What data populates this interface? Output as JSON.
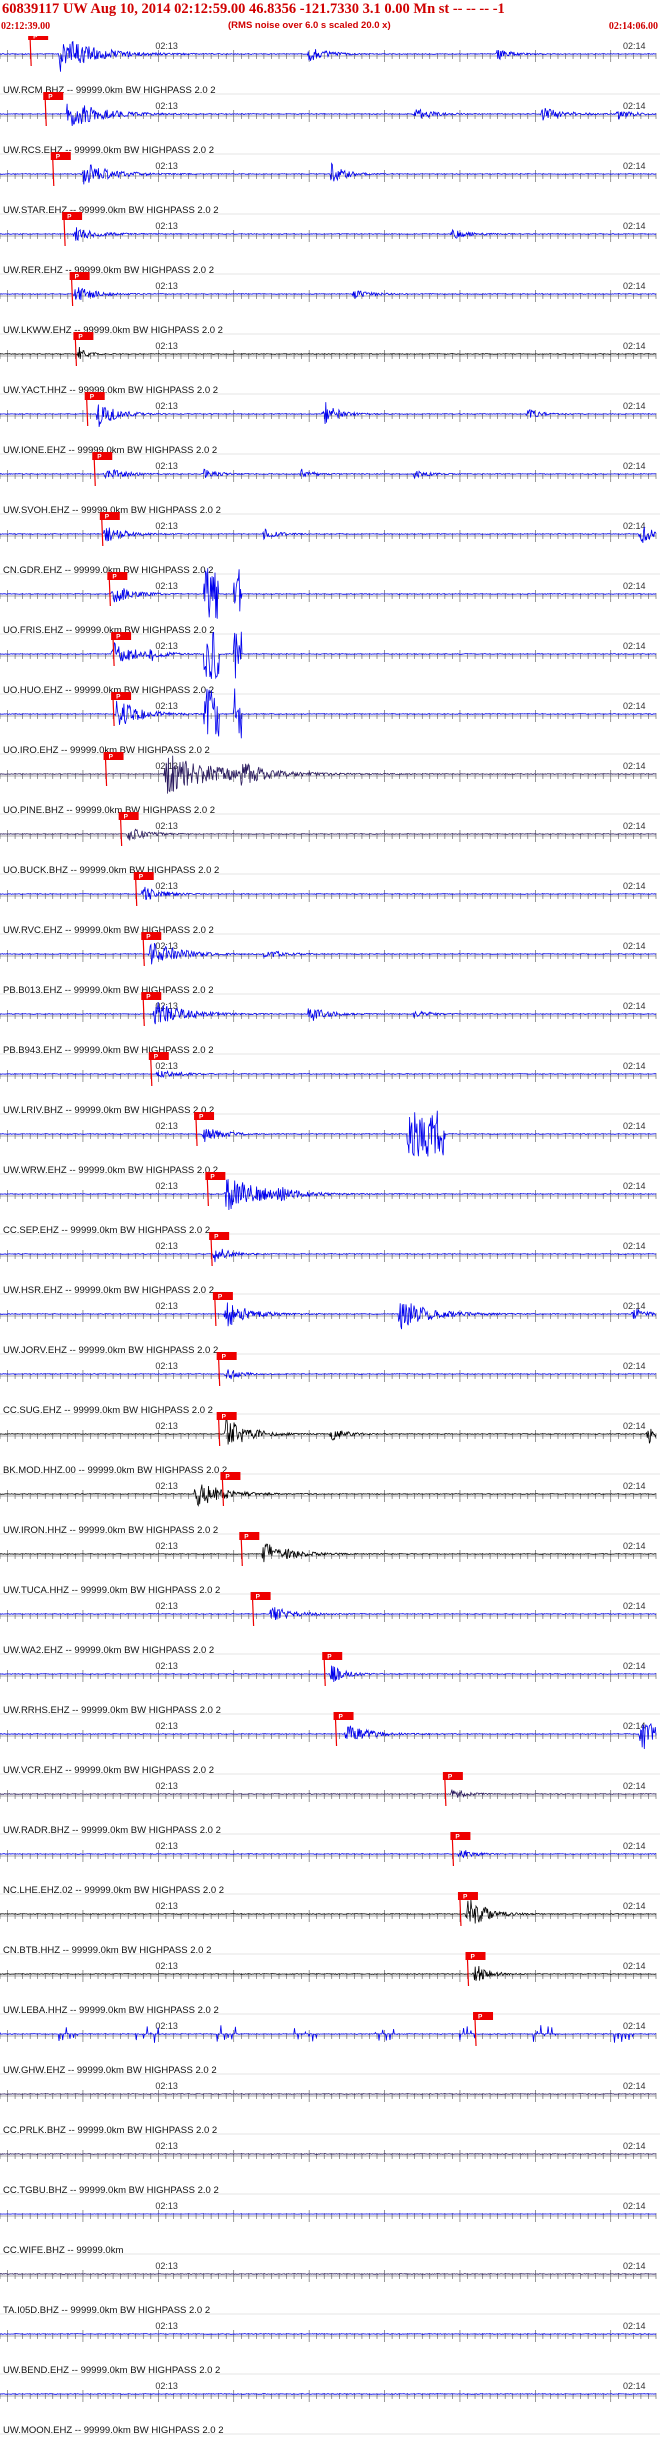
{
  "header": {
    "title": "60839117 UW Aug 10, 2014 02:12:59.00   46.8356 -121.7330  3.1 0.00 Mn st -- -- --  -1",
    "subtitle": "(RMS noise over 6.0 s scaled 20.0 x)",
    "time_start": "02:12:39.00",
    "time_end": "02:14:06.00"
  },
  "colors": {
    "header_text": "#d00000",
    "trace_blue": "#0000ee",
    "trace_black": "#000000",
    "trace_purple": "#2a1a5e",
    "pick_red": "#ee0000",
    "tick_gray": "#555555",
    "divider": "#cccccc"
  },
  "chart_data": {
    "type": "line",
    "x_axis": {
      "start": "02:12:39.00",
      "end": "02:14:06.00",
      "minor_tick_seconds": 1
    },
    "tick_labels": {
      "mid": "02:13",
      "end": "02:14"
    },
    "pick_label": "P",
    "series": [
      {
        "label": "UW.RCM.BHZ -- 99999.0km BW  HIGHPASS  2.0  2",
        "color": "blue",
        "pick_t": 4,
        "bursts": [
          [
            8,
            2.6,
            8
          ],
          [
            41,
            1.1,
            4
          ],
          [
            66,
            0.9,
            3
          ]
        ]
      },
      {
        "label": "UW.RCS.EHZ -- 99999.0km BW  HIGHPASS  2.0  2",
        "color": "blue",
        "pick_t": 6,
        "bursts": [
          [
            9,
            2.2,
            7
          ],
          [
            55,
            0.9,
            4
          ],
          [
            72,
            1.0,
            5
          ],
          [
            82,
            0.8,
            3
          ]
        ]
      },
      {
        "label": "UW.STAR.EHZ -- 99999.0km BW  HIGHPASS  2.0  2",
        "color": "blue",
        "pick_t": 7,
        "bursts": [
          [
            11,
            1.8,
            6
          ],
          [
            44,
            1.6,
            3
          ]
        ]
      },
      {
        "label": "UW.RER.EHZ -- 99999.0km BW  HIGHPASS  2.0  2",
        "color": "blue",
        "pick_t": 8.5,
        "bursts": [
          [
            10,
            1.0,
            5
          ],
          [
            60,
            0.7,
            4
          ]
        ]
      },
      {
        "label": "UW.LKWW.EHZ -- 99999.0km BW  HIGHPASS  2.0  2",
        "color": "blue",
        "pick_t": 9.5,
        "bursts": [
          [
            10,
            1.3,
            4
          ],
          [
            47,
            0.6,
            4
          ]
        ]
      },
      {
        "label": "UW.YACT.HHZ -- 99999.0km BW  HIGHPASS  2.0  2",
        "color": "black",
        "pick_t": 10,
        "bursts": [
          [
            10.5,
            1.2,
            2
          ]
        ]
      },
      {
        "label": "UW.IONE.EHZ -- 99999.0km BW  HIGHPASS  2.0  2",
        "color": "blue",
        "pick_t": 11.5,
        "bursts": [
          [
            13,
            2.0,
            4
          ],
          [
            43,
            2.0,
            3
          ],
          [
            70,
            0.7,
            3
          ]
        ]
      },
      {
        "label": "UW.SVOH.EHZ -- 99999.0km BW  HIGHPASS  2.0  2",
        "color": "blue",
        "pick_t": 12.5,
        "bursts": [
          [
            14,
            1.0,
            4
          ],
          [
            27,
            0.8,
            3
          ],
          [
            40,
            0.7,
            3
          ],
          [
            55,
            0.6,
            3
          ]
        ]
      },
      {
        "label": "CN.GDR.EHZ -- 99999.0km BW  HIGHPASS  2.0  2",
        "color": "blue",
        "pick_t": 13.5,
        "bursts": [
          [
            14,
            1.3,
            4
          ],
          [
            35,
            0.8,
            3
          ],
          [
            85,
            1.5,
            3
          ]
        ]
      },
      {
        "label": "UO.FRIS.EHZ -- 99999.0km BW  HIGHPASS  2.0  2",
        "color": "blue",
        "pick_t": 14.5,
        "bursts": [
          [
            15,
            1.5,
            4
          ]
        ],
        "blocks": [
          [
            27,
            29,
            1.0
          ],
          [
            31,
            32,
            1.0
          ]
        ]
      },
      {
        "label": "UO.HUO.EHZ -- 99999.0km BW  HIGHPASS  2.0  2",
        "color": "blue",
        "pick_t": 15,
        "bursts": [
          [
            15,
            1.8,
            5
          ],
          [
            20,
            0.9,
            2
          ]
        ],
        "blocks": [
          [
            27,
            29,
            1.0
          ],
          [
            31,
            32,
            1.0
          ]
        ]
      },
      {
        "label": "UO.IRO.EHZ -- 99999.0km BW  HIGHPASS  2.0  2",
        "color": "blue",
        "pick_t": 15,
        "bursts": [
          [
            15.5,
            2.2,
            5
          ]
        ],
        "blocks": [
          [
            27,
            29,
            1.0
          ],
          [
            31,
            32,
            1.0
          ]
        ]
      },
      {
        "label": "UO.PINE.BHZ -- 99999.0km BW  HIGHPASS  2.0  2",
        "color": "purple",
        "pick_t": 14,
        "bursts": [
          [
            22,
            3.0,
            12
          ],
          [
            32,
            1.4,
            4
          ]
        ]
      },
      {
        "label": "UO.BUCK.BHZ -- 99999.0km BW  HIGHPASS  2.0  2",
        "color": "purple",
        "pick_t": 16,
        "bursts": [
          [
            17,
            1.0,
            4
          ]
        ]
      },
      {
        "label": "UW.RVC.EHZ -- 99999.0km BW  HIGHPASS  2.0  2",
        "color": "blue",
        "pick_t": 18,
        "bursts": [
          [
            19,
            1.2,
            4
          ]
        ]
      },
      {
        "label": "PB.B013.EHZ -- 99999.0km BW  HIGHPASS  2.0  2",
        "color": "blue",
        "pick_t": 19,
        "bursts": [
          [
            20,
            2.0,
            6
          ],
          [
            35,
            0.7,
            4
          ]
        ]
      },
      {
        "label": "PB.B943.EHZ -- 99999.0km BW  HIGHPASS  2.0  2",
        "color": "blue",
        "pick_t": 19,
        "bursts": [
          [
            20.5,
            2.2,
            6
          ],
          [
            41,
            1.2,
            4
          ],
          [
            55,
            0.7,
            3
          ]
        ]
      },
      {
        "label": "UW.LRIV.BHZ -- 99999.0km BW  HIGHPASS  2.0  2",
        "color": "blue",
        "pick_t": 20,
        "bursts": [
          [
            21,
            0.8,
            4
          ]
        ]
      },
      {
        "label": "UW.WRW.EHZ -- 99999.0km BW  HIGHPASS  2.0  2",
        "color": "blue",
        "pick_t": 26,
        "bursts": [
          [
            27,
            1.3,
            4
          ]
        ],
        "blocks": [
          [
            54,
            59,
            0.9
          ]
        ]
      },
      {
        "label": "CC.SEP.EHZ -- 99999.0km BW  HIGHPASS  2.0  2",
        "color": "blue",
        "pick_t": 27.5,
        "bursts": [
          [
            30,
            3.0,
            7
          ],
          [
            37,
            0.7,
            4
          ]
        ]
      },
      {
        "label": "UW.HSR.EHZ -- 99999.0km BW  HIGHPASS  2.0  2",
        "color": "blue",
        "pick_t": 28,
        "bursts": [
          [
            28.5,
            1.3,
            3
          ]
        ]
      },
      {
        "label": "UW.JORV.EHZ -- 99999.0km BW  HIGHPASS  2.0  2",
        "color": "blue",
        "pick_t": 28.5,
        "bursts": [
          [
            30,
            2.0,
            5
          ],
          [
            53,
            2.3,
            7
          ],
          [
            84,
            0.9,
            3
          ]
        ]
      },
      {
        "label": "CC.SUG.EHZ -- 99999.0km BW  HIGHPASS  2.0  2",
        "color": "blue",
        "pick_t": 29,
        "bursts": [
          [
            30,
            1.0,
            3
          ]
        ]
      },
      {
        "label": "BK.MOD.HHZ.00 -- 99999.0km BW  HIGHPASS  2.0  2",
        "color": "black",
        "pick_t": 29,
        "bursts": [
          [
            30,
            2.4,
            5
          ],
          [
            44,
            1.2,
            3
          ],
          [
            86,
            1.4,
            3
          ]
        ]
      },
      {
        "label": "UW.IRON.HHZ -- 99999.0km BW  HIGHPASS  2.0  2",
        "color": "black",
        "pick_t": 29.5,
        "bursts": [
          [
            26,
            2.0,
            6
          ]
        ]
      },
      {
        "label": "UW.TUCA.HHZ -- 99999.0km BW  HIGHPASS  2.0  2",
        "color": "black",
        "pick_t": 32,
        "bursts": [
          [
            35,
            1.8,
            6
          ]
        ]
      },
      {
        "label": "UW.WA2.EHZ -- 99999.0km BW  HIGHPASS  2.0  2",
        "color": "blue",
        "pick_t": 33.5,
        "bursts": [
          [
            36,
            1.1,
            5
          ]
        ]
      },
      {
        "label": "UW.RRHS.EHZ -- 99999.0km BW  HIGHPASS  2.0  2",
        "color": "blue",
        "pick_t": 43,
        "bursts": [
          [
            44,
            1.5,
            3
          ]
        ]
      },
      {
        "label": "UW.VCR.EHZ -- 99999.0km BW  HIGHPASS  2.0  2",
        "color": "blue",
        "pick_t": 44.5,
        "bursts": [
          [
            46,
            1.5,
            5
          ],
          [
            85,
            2.6,
            4
          ]
        ]
      },
      {
        "label": "UW.RADR.BHZ -- 99999.0km BW  HIGHPASS  2.0  2",
        "color": "purple",
        "pick_t": 59,
        "bursts": [
          [
            60,
            0.8,
            3
          ]
        ]
      },
      {
        "label": "NC.LHE.EHZ.02 -- 99999.0km BW  HIGHPASS  2.0  2",
        "color": "blue",
        "pick_t": 60,
        "bursts": [
          [
            61,
            0.8,
            3
          ]
        ]
      },
      {
        "label": "CN.BTB.HHZ -- 99999.0km BW  HIGHPASS  2.0  2",
        "color": "black",
        "pick_t": 61,
        "bursts": [
          [
            62,
            2.6,
            4
          ]
        ]
      },
      {
        "label": "UW.LEBA.HHZ -- 99999.0km BW  HIGHPASS  2.0  2",
        "color": "black",
        "pick_t": 62,
        "bursts": [
          [
            63,
            1.5,
            3
          ]
        ]
      },
      {
        "label": "UW.GHW.EHZ -- 99999.0km BW  HIGHPASS  2.0  2",
        "color": "blue",
        "pick_t": 63,
        "bursts": [],
        "spikes": true
      },
      {
        "label": "CC.PRLK.BHZ -- 99999.0km BW  HIGHPASS  2.0  2",
        "color": "purple",
        "pick_t": null,
        "bursts": []
      },
      {
        "label": "CC.TGBU.BHZ -- 99999.0km BW  HIGHPASS  2.0  2",
        "color": "purple",
        "pick_t": null,
        "bursts": []
      },
      {
        "label": "CC.WIFE.BHZ -- 99999.0km",
        "color": "blue",
        "pick_t": null,
        "bursts": [],
        "flat": true
      },
      {
        "label": "TA.I05D.BHZ -- 99999.0km BW  HIGHPASS  2.0  2",
        "color": "purple",
        "pick_t": null,
        "bursts": []
      },
      {
        "label": "UW.BEND.EHZ -- 99999.0km BW  HIGHPASS  2.0  2",
        "color": "blue",
        "pick_t": null,
        "bursts": []
      },
      {
        "label": "UW.MOON.EHZ -- 99999.0km BW  HIGHPASS  2.0  2",
        "color": "blue",
        "pick_t": null,
        "bursts": []
      }
    ]
  }
}
